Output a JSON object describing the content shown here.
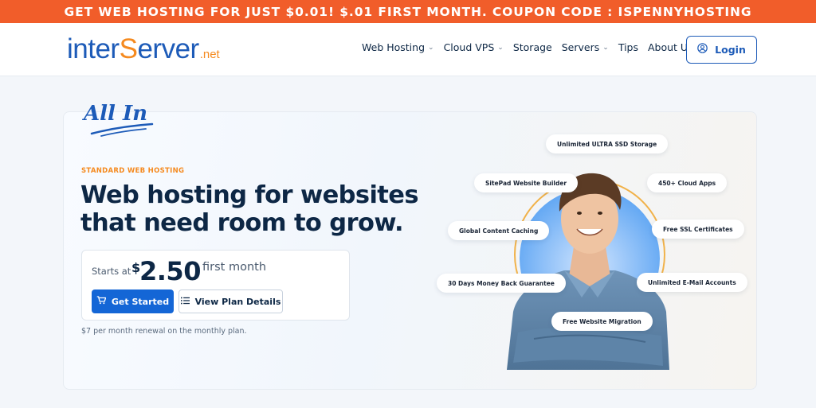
{
  "promo": {
    "text": "GET WEB HOSTING FOR JUST $0.01! $.01 FIRST MONTH. COUPON CODE : ISPENNYHOSTING"
  },
  "logo": {
    "part1": "inter",
    "part2": "erver",
    "s": "S",
    "suffix": ".net"
  },
  "nav": {
    "items": [
      {
        "label": "Web Hosting",
        "has_dropdown": true
      },
      {
        "label": "Cloud VPS",
        "has_dropdown": true
      },
      {
        "label": "Storage",
        "has_dropdown": false
      },
      {
        "label": "Servers",
        "has_dropdown": true
      },
      {
        "label": "Tips",
        "has_dropdown": false
      },
      {
        "label": "About Us",
        "has_dropdown": true
      }
    ],
    "login_label": "Login"
  },
  "hero": {
    "badge": "All In",
    "eyebrow": "STANDARD WEB HOSTING",
    "headline_line1": "Web hosting for websites",
    "headline_line2": "that need room to grow.",
    "price": {
      "starts_label": "Starts at",
      "currency": "$",
      "amount": "2.50",
      "period": "first month"
    },
    "cta_primary": "Get Started",
    "cta_secondary": "View Plan Details",
    "renewal_note": "$7 per month renewal on the monthly plan."
  },
  "features": [
    "Unlimited ULTRA SSD Storage",
    "SitePad Website Builder",
    "450+ Cloud Apps",
    "Global Content Caching",
    "Free SSL Certificates",
    "30 Days Money Back Guarantee",
    "Unlimited E-Mail Accounts",
    "Free Website Migration"
  ],
  "colors": {
    "promo_bg": "#f15d2a",
    "brand_blue": "#1d5bb8",
    "brand_orange": "#f58a1f",
    "cta_blue": "#1466d6",
    "heading": "#0d2745"
  },
  "icons": {
    "login": "user-circle-icon",
    "get_started": "cart-icon",
    "view_plan": "list-icon",
    "dropdown": "chevron-down-icon"
  }
}
